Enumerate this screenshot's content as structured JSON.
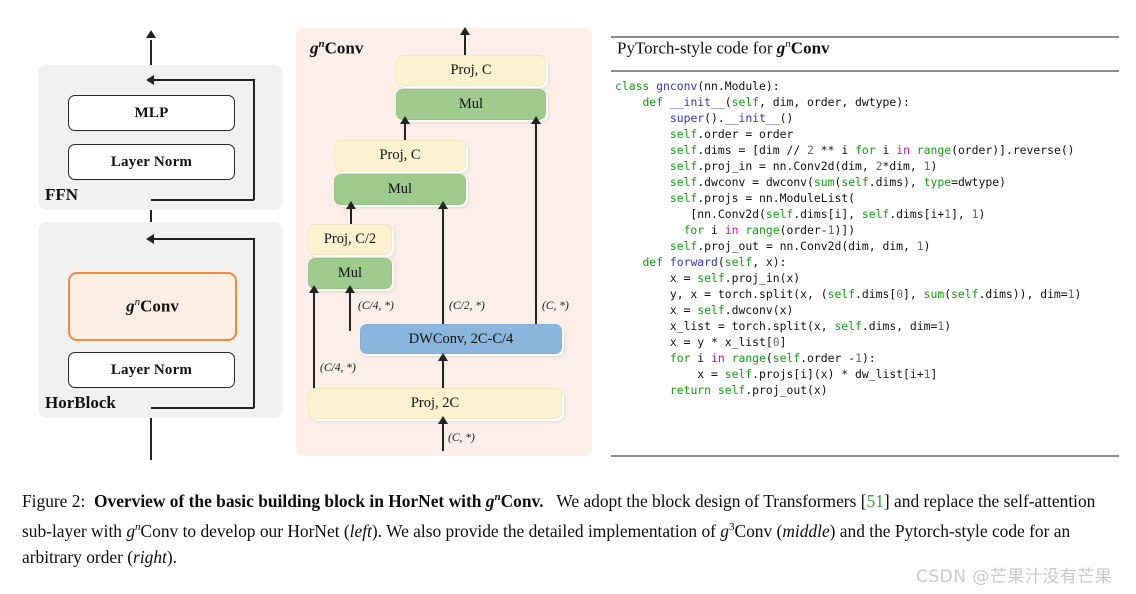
{
  "left_panel": {
    "groups": [
      {
        "name": "FFN",
        "label": "FFN"
      },
      {
        "name": "HorBlock",
        "label": "HorBlock"
      }
    ],
    "boxes": {
      "mlp": "MLP",
      "layer_norm_top": "Layer Norm",
      "gnconv": "Conv",
      "gnconv_prefix": "g",
      "gnconv_order": "n",
      "layer_norm_bottom": "Layer Norm"
    }
  },
  "middle_panel": {
    "title_prefix": "g",
    "title_order": "n",
    "title_suffix": "Conv",
    "nodes": {
      "proj_c_top": "Proj, C",
      "mul_top": "Mul",
      "proj_c_mid": "Proj, C",
      "mul_mid": "Mul",
      "proj_c2": "Proj, C/2",
      "mul_bottom": "Mul",
      "dwconv": "DWConv, 2C-C/4",
      "proj_2c": "Proj, 2C"
    },
    "tensor_labels": {
      "dw_out_c4": "(C/4, *)",
      "dw_out_c2": "(C/2, *)",
      "dw_out_c": "(C, *)",
      "proj_out_c4": "(C/4, *)",
      "input_c": "(C, *)"
    },
    "colors": {
      "panel_bg": "#fcefe9",
      "yellow": "#fdf2cf",
      "green": "#9fcb8e",
      "blue": "#8ab6dd"
    }
  },
  "code_panel": {
    "header": "PyTorch-style code for ",
    "header_g": "g",
    "header_order": "n",
    "header_conv": "Conv",
    "lines": [
      [
        [
          "kw",
          "class "
        ],
        [
          "fn",
          "gnconv"
        ],
        [
          "pl",
          "(nn.Module):"
        ]
      ],
      [
        [
          "pl",
          "    "
        ],
        [
          "kw",
          "def "
        ],
        [
          "fn",
          "__init__"
        ],
        [
          "pl",
          "("
        ],
        [
          "kw",
          "self"
        ],
        [
          "pl",
          ", dim, order, dwtype):"
        ]
      ],
      [
        [
          "pl",
          "        "
        ],
        [
          "fn",
          "super"
        ],
        [
          "pl",
          "()."
        ],
        [
          "fn",
          "__init__"
        ],
        [
          "pl",
          "()"
        ]
      ],
      [
        [
          "pl",
          "        "
        ],
        [
          "kw",
          "self"
        ],
        [
          "pl",
          ".order = order"
        ]
      ],
      [
        [
          "pl",
          "        "
        ],
        [
          "kw",
          "self"
        ],
        [
          "pl",
          ".dims = [dim // "
        ],
        [
          "num",
          "2"
        ],
        [
          "pl",
          " ** i "
        ],
        [
          "kw",
          "for"
        ],
        [
          "pl",
          " i "
        ],
        [
          "op",
          "in"
        ],
        [
          "pl",
          " "
        ],
        [
          "kw",
          "range"
        ],
        [
          "pl",
          "(order)].reverse()"
        ]
      ],
      [
        [
          "pl",
          "        "
        ],
        [
          "kw",
          "self"
        ],
        [
          "pl",
          ".proj_in = nn.Conv2d(dim, "
        ],
        [
          "num",
          "2"
        ],
        [
          "pl",
          "*dim, "
        ],
        [
          "num",
          "1"
        ],
        [
          "pl",
          ")"
        ]
      ],
      [
        [
          "pl",
          "        "
        ],
        [
          "kw",
          "self"
        ],
        [
          "pl",
          ".dwconv = dwconv("
        ],
        [
          "kw",
          "sum"
        ],
        [
          "pl",
          "("
        ],
        [
          "kw",
          "self"
        ],
        [
          "pl",
          ".dims), "
        ],
        [
          "kw",
          "type"
        ],
        [
          "pl",
          "=dwtype)"
        ]
      ],
      [
        [
          "pl",
          "        "
        ],
        [
          "kw",
          "self"
        ],
        [
          "pl",
          ".projs = nn.ModuleList("
        ]
      ],
      [
        [
          "pl",
          "           [nn.Conv2d("
        ],
        [
          "kw",
          "self"
        ],
        [
          "pl",
          ".dims[i], "
        ],
        [
          "kw",
          "self"
        ],
        [
          "pl",
          ".dims[i+"
        ],
        [
          "num",
          "1"
        ],
        [
          "pl",
          "], "
        ],
        [
          "num",
          "1"
        ],
        [
          "pl",
          ")"
        ]
      ],
      [
        [
          "pl",
          "          "
        ],
        [
          "kw",
          "for"
        ],
        [
          "pl",
          " i "
        ],
        [
          "op",
          "in"
        ],
        [
          "pl",
          " "
        ],
        [
          "kw",
          "range"
        ],
        [
          "pl",
          "(order-"
        ],
        [
          "num",
          "1"
        ],
        [
          "pl",
          ")])"
        ]
      ],
      [
        [
          "pl",
          "        "
        ],
        [
          "kw",
          "self"
        ],
        [
          "pl",
          ".proj_out = nn.Conv2d(dim, dim, "
        ],
        [
          "num",
          "1"
        ],
        [
          "pl",
          ")"
        ]
      ],
      [
        [
          "pl",
          ""
        ]
      ],
      [
        [
          "pl",
          "    "
        ],
        [
          "kw",
          "def "
        ],
        [
          "fn",
          "forward"
        ],
        [
          "pl",
          "("
        ],
        [
          "kw",
          "self"
        ],
        [
          "pl",
          ", x):"
        ]
      ],
      [
        [
          "pl",
          "        x = "
        ],
        [
          "kw",
          "self"
        ],
        [
          "pl",
          ".proj_in(x)"
        ]
      ],
      [
        [
          "pl",
          "        y, x = torch.split(x, ("
        ],
        [
          "kw",
          "self"
        ],
        [
          "pl",
          ".dims["
        ],
        [
          "num",
          "0"
        ],
        [
          "pl",
          "], "
        ],
        [
          "kw",
          "sum"
        ],
        [
          "pl",
          "("
        ],
        [
          "kw",
          "self"
        ],
        [
          "pl",
          ".dims)), dim="
        ],
        [
          "num",
          "1"
        ],
        [
          "pl",
          ")"
        ]
      ],
      [
        [
          "pl",
          "        x = "
        ],
        [
          "kw",
          "self"
        ],
        [
          "pl",
          ".dwconv(x)"
        ]
      ],
      [
        [
          "pl",
          "        x_list = torch.split(x, "
        ],
        [
          "kw",
          "self"
        ],
        [
          "pl",
          ".dims, dim="
        ],
        [
          "num",
          "1"
        ],
        [
          "pl",
          ")"
        ]
      ],
      [
        [
          "pl",
          "        x = y * x_list["
        ],
        [
          "num",
          "0"
        ],
        [
          "pl",
          "]"
        ]
      ],
      [
        [
          "pl",
          "        "
        ],
        [
          "kw",
          "for"
        ],
        [
          "pl",
          " i "
        ],
        [
          "op",
          "in"
        ],
        [
          "pl",
          " "
        ],
        [
          "kw",
          "range"
        ],
        [
          "pl",
          "("
        ],
        [
          "kw",
          "self"
        ],
        [
          "pl",
          ".order -"
        ],
        [
          "num",
          "1"
        ],
        [
          "pl",
          "):"
        ]
      ],
      [
        [
          "pl",
          "            x = "
        ],
        [
          "kw",
          "self"
        ],
        [
          "pl",
          ".projs[i](x) * dw_list[i+"
        ],
        [
          "num",
          "1"
        ],
        [
          "pl",
          "]"
        ]
      ],
      [
        [
          "pl",
          "        "
        ],
        [
          "kw",
          "return"
        ],
        [
          "pl",
          " "
        ],
        [
          "kw",
          "self"
        ],
        [
          "pl",
          ".proj_out(x)"
        ]
      ]
    ],
    "syntax_colors": {
      "keyword": "#12a012",
      "function": "#3434c4",
      "operator": "#c213c2",
      "number": "#686868",
      "plain": "#111111"
    }
  },
  "caption": {
    "figure_number": "Figure 2:",
    "bold_title_a": "Overview of the basic building block in HorNet with ",
    "bold_title_g": "g",
    "bold_title_order": "n",
    "bold_title_conv": "Conv.",
    "body_1": "We adopt the block design of Transformers [",
    "citation": "51",
    "body_2": "] and replace the self-attention sub-layer with ",
    "body_g1": "g",
    "body_g1_order": "n",
    "body_3": "Conv to develop our HorNet (",
    "italic_left": "left",
    "body_4": "). We also provide the detailed implementation of ",
    "body_g2": "g",
    "body_g2_order": "3",
    "body_5": "Conv (",
    "italic_middle": "middle",
    "body_6": ") and the Pytorch-style code for an arbitrary order (",
    "italic_right": "right",
    "body_7": ")."
  },
  "watermark": {
    "text": "CSDN @芒果汁没有芒果"
  }
}
